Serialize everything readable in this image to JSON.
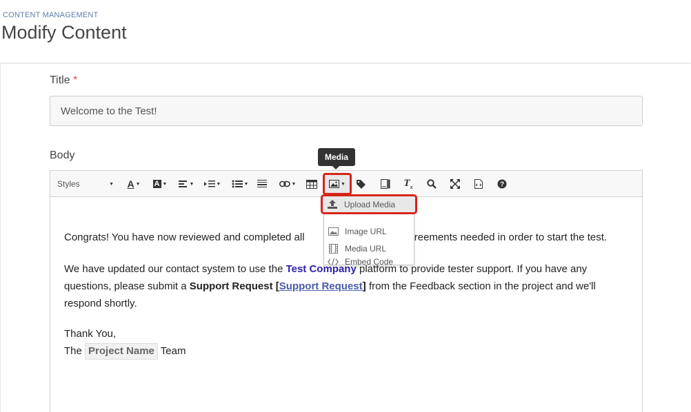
{
  "header": {
    "breadcrumb": "CONTENT MANAGEMENT",
    "title": "Modify Content"
  },
  "form": {
    "title_label": "Title",
    "required_mark": "*",
    "title_value": "Welcome to the Test!",
    "body_label": "Body"
  },
  "toolbar": {
    "styles_label": "Styles",
    "tooltip": "Media",
    "icons": [
      "font-color-icon",
      "background-color-icon",
      "align-icon",
      "indent-icon",
      "list-icon",
      "horizontal-rule-icon",
      "link-icon",
      "table-icon",
      "image-icon",
      "tag-icon",
      "template-icon",
      "clear-format-icon",
      "search-icon",
      "fullscreen-icon",
      "source-icon",
      "help-icon"
    ]
  },
  "media_menu": {
    "items": [
      {
        "label": "Upload Media",
        "icon": "upload-icon"
      },
      {
        "label": "Image URL",
        "icon": "image-icon"
      },
      {
        "label": "Media URL",
        "icon": "film-icon"
      },
      {
        "label": "Embed Code",
        "icon": "code-icon"
      }
    ]
  },
  "body": {
    "p1_a": "Congrats! You have now reviewed and completed all",
    "p1_b": "d agreements needed in order to start the test.",
    "p2_a": "We have updated our contact system to use the ",
    "p2_brand": "Test Company",
    "p2_b": " platform to provide tester support.  If you have any questions, please submit a ",
    "p2_bold": "Support Request",
    "p2_open": " [",
    "p2_link": "Support Request",
    "p2_c": "] from the Feedback section in the project and we'll respond shortly.",
    "p3_line1": "Thank You,",
    "p3_the": "The ",
    "p3_placeholder": "Project Name",
    "p3_team": " Team"
  }
}
